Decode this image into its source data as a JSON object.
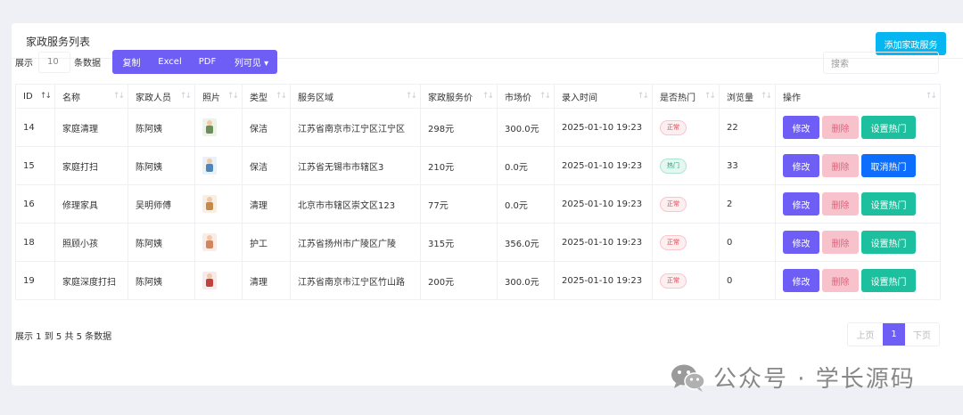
{
  "page": {
    "title": "家政服务列表",
    "add_button": "添加家政服务"
  },
  "toolbar": {
    "show_prefix": "展示",
    "page_length": "10",
    "show_suffix": "条数据",
    "buttons": [
      "复制",
      "Excel",
      "PDF",
      "列可见 ▾"
    ],
    "search_placeholder": "搜索"
  },
  "table": {
    "columns": [
      "ID",
      "名称",
      "家政人员",
      "照片",
      "类型",
      "服务区域",
      "家政服务价",
      "市场价",
      "录入时间",
      "是否热门",
      "浏览量",
      "操作"
    ],
    "rows": [
      {
        "id": "14",
        "name": "家庭清理",
        "staff": "陈阿姨",
        "photo": "photo-cleaner",
        "type": "保洁",
        "area": "江苏省南京市江宁区江宁区",
        "price": "298元",
        "market": "300.0元",
        "time": "2025-01-10 19:23",
        "hot": "正常",
        "hot_state": "normal",
        "views": "22",
        "edit": "修改",
        "delete": "删除",
        "toggle": "设置热门"
      },
      {
        "id": "15",
        "name": "家庭打扫",
        "staff": "陈阿姨",
        "photo": "photo-cleaner-2",
        "type": "保洁",
        "area": "江苏省无锡市市辖区3",
        "price": "210元",
        "market": "0.0元",
        "time": "2025-01-10 19:23",
        "hot": "热门",
        "hot_state": "hot",
        "views": "33",
        "edit": "修改",
        "delete": "删除",
        "toggle": "取消热门"
      },
      {
        "id": "16",
        "name": "修理家具",
        "staff": "吴明师傅",
        "photo": "photo-mover",
        "type": "清理",
        "area": "北京市市辖区崇文区123",
        "price": "77元",
        "market": "0.0元",
        "time": "2025-01-10 19:23",
        "hot": "正常",
        "hot_state": "normal",
        "views": "2",
        "edit": "修改",
        "delete": "删除",
        "toggle": "设置热门"
      },
      {
        "id": "18",
        "name": "照顾小孩",
        "staff": "陈阿姨",
        "photo": "photo-nanny",
        "type": "护工",
        "area": "江苏省扬州市广陵区广陵",
        "price": "315元",
        "market": "356.0元",
        "time": "2025-01-10 19:23",
        "hot": "正常",
        "hot_state": "normal",
        "views": "0",
        "edit": "修改",
        "delete": "删除",
        "toggle": "设置热门"
      },
      {
        "id": "19",
        "name": "家庭深度打扫",
        "staff": "陈阿姨",
        "photo": "photo-maid",
        "type": "清理",
        "area": "江苏省南京市江宁区竹山路",
        "price": "200元",
        "market": "300.0元",
        "time": "2025-01-10 19:23",
        "hot": "正常",
        "hot_state": "normal",
        "views": "0",
        "edit": "修改",
        "delete": "删除",
        "toggle": "设置热门"
      }
    ]
  },
  "footer": {
    "info": "展示 1 到 5 共 5 条数据",
    "prev": "上页",
    "current_page": "1",
    "next": "下页"
  },
  "watermark": {
    "text": "公众号 · 学长源码",
    "icon": "wechat-icon"
  },
  "colors": {
    "primary": "#6f5ef5",
    "add": "#06b6f0",
    "set_hot": "#1cc09f",
    "cancel_hot": "#0d6efd",
    "delete": "#f7c2cc"
  }
}
